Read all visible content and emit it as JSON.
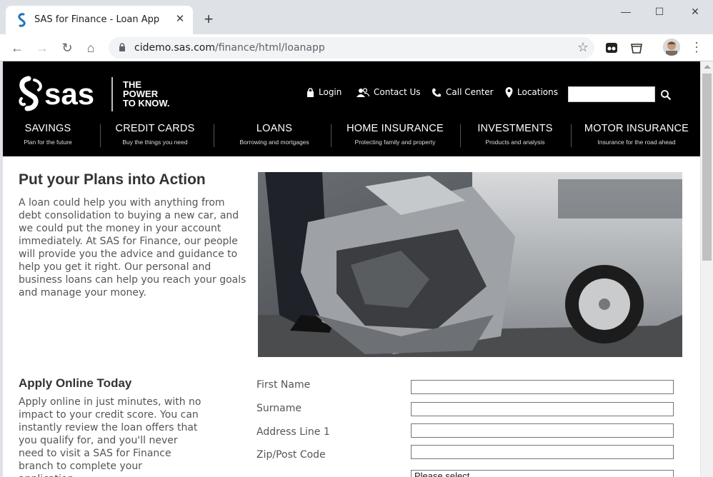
{
  "browser": {
    "tab_title": "SAS for Finance - Loan App",
    "url_host": "cidemo.sas.com",
    "url_path": "/finance/html/loanapp"
  },
  "header": {
    "logo_text": "sas",
    "tagline": "THE POWER TO KNOW.",
    "utility_links": [
      "Login",
      "Contact Us",
      "Call Center",
      "Locations"
    ],
    "search_value": "",
    "nav": [
      {
        "label": "SAVINGS",
        "sub": "Plan for the future"
      },
      {
        "label": "CREDIT CARDS",
        "sub": "Buy the things you need"
      },
      {
        "label": "LOANS",
        "sub": "Borrowing and mortgages"
      },
      {
        "label": "HOME INSURANCE",
        "sub": "Protecting family and property"
      },
      {
        "label": "INVESTMENTS",
        "sub": "Products and analysis"
      },
      {
        "label": "MOTOR INSURANCE",
        "sub": "Insurance for the road ahead"
      }
    ]
  },
  "main": {
    "heading": "Put your Plans into Action",
    "intro": "A loan could help you with anything from debt consolidation to buying a new car, and we could put the money in your account immediately. At SAS for Finance, our people will provide you the advice and guidance to help you get it right. Our personal and business loans can help you reach your goals and manage your money.",
    "apply_heading": "Apply Online Today",
    "apply_text": "Apply online in just minutes, with no impact to your credit score. You can instantly review the loan offers that you qualify for, and you'll never need to visit a SAS for Finance branch to complete your application..",
    "form": {
      "fields": [
        {
          "label": "First Name",
          "value": ""
        },
        {
          "label": "Surname",
          "value": ""
        },
        {
          "label": "Address Line 1",
          "value": ""
        },
        {
          "label": "Zip/Post Code",
          "value": ""
        }
      ],
      "select_value": "Please select"
    }
  }
}
